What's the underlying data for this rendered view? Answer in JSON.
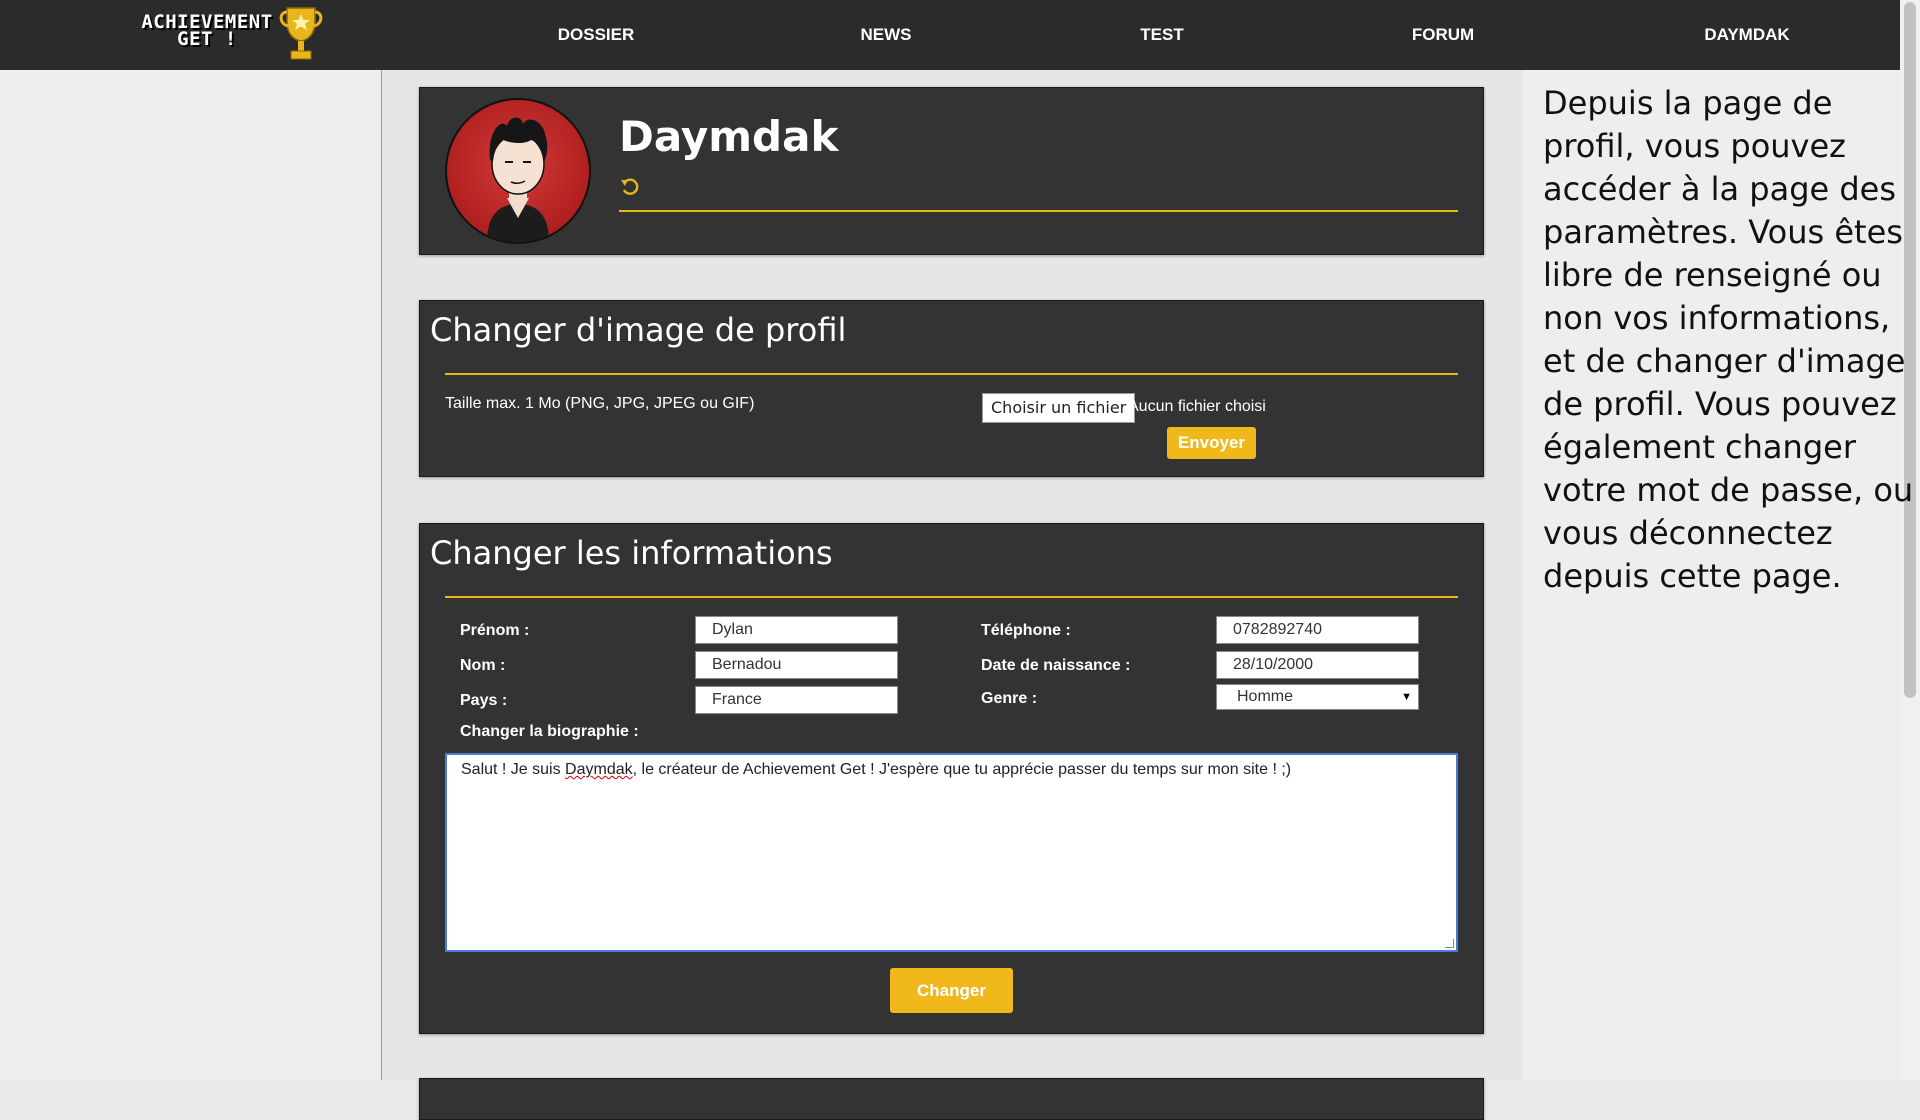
{
  "nav": {
    "logo_line1": "ACHIEVEMENT",
    "logo_line2": "GET !",
    "links": [
      "DOSSIER",
      "NEWS",
      "TEST",
      "FORUM",
      "DAYMDAK"
    ]
  },
  "help": {
    "text": "Depuis la page de profil, vous pouvez accéder à la page des paramètres. Vous êtes libre de renseigné ou non vos informations, et de changer d'image de profil. Vous pouvez également changer votre mot de passe, ou vous déconnectez depuis cette page."
  },
  "profile": {
    "username": "Daymdak",
    "refresh_icon": "refresh-icon",
    "avatar_icon": "avatar-icon"
  },
  "image_section": {
    "title": "Changer d'image de profil",
    "size_hint": "Taille max. 1 Mo (PNG, JPG, JPEG ou GIF)",
    "choose_file": "Choisir un fichier",
    "no_file": "Aucun fichier choisi",
    "send": "Envoyer"
  },
  "info_section": {
    "title": "Changer les informations",
    "labels": {
      "firstname": "Prénom :",
      "lastname": "Nom :",
      "country": "Pays :",
      "phone": "Téléphone :",
      "birthdate": "Date de naissance :",
      "gender": "Genre :",
      "bio": "Changer la biographie :"
    },
    "values": {
      "firstname": "Dylan",
      "lastname": "Bernadou",
      "country": "France",
      "phone": "0782892740",
      "birthdate": "28/10/2000",
      "gender": "Homme"
    },
    "bio": {
      "before": "Salut ! Je suis ",
      "misspelled": "Daymdak",
      "after": ", le créateur de Achievement Get ! J'espère que tu apprécie passer du temps sur mon site ! ;)"
    },
    "submit": "Changer"
  },
  "colors": {
    "accent": "#f0b81a",
    "panel": "#333333",
    "navbar": "#2b2b2b"
  }
}
